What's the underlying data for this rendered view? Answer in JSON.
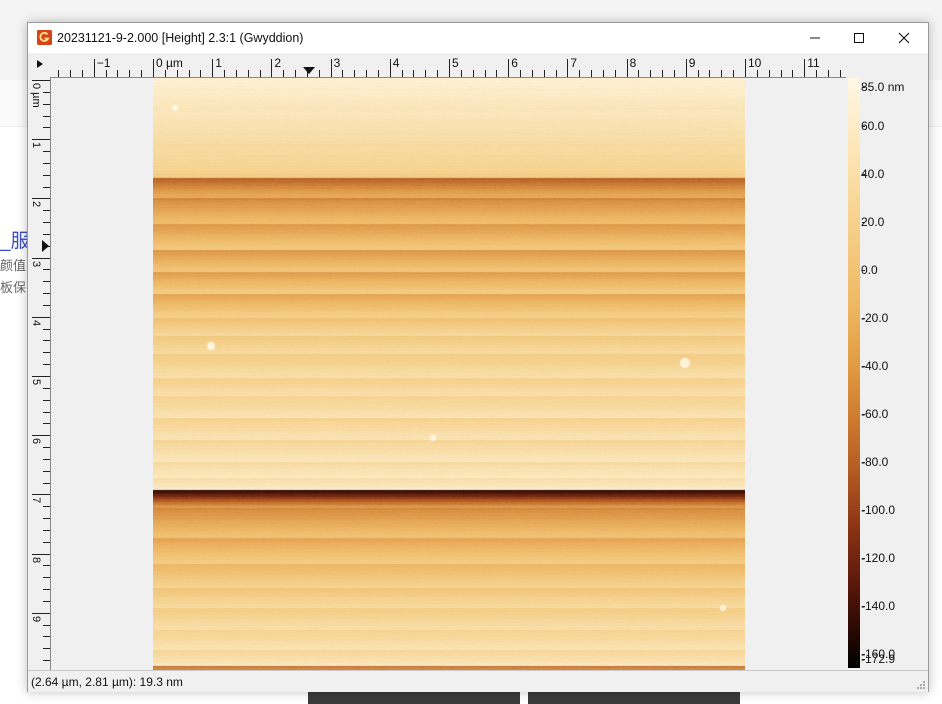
{
  "background": {
    "link_text": "_服",
    "line1": "颜值",
    "line2": "板保"
  },
  "window": {
    "title": "20231121-9-2.000 [Height] 2.3:1 (Gwyddion)",
    "minimize_label": "—",
    "maximize_label": "☐",
    "close_label": "✕"
  },
  "hruler": {
    "labels": [
      "−1",
      "0 µm",
      "1",
      "2",
      "3",
      "4",
      "5",
      "6",
      "7",
      "8",
      "9",
      "10",
      "11"
    ]
  },
  "vruler": {
    "labels": [
      "0 µm",
      "1",
      "2",
      "3",
      "4",
      "5",
      "6",
      "7",
      "8",
      "9"
    ]
  },
  "colorbar": {
    "labels": [
      "85.0 nm",
      "60.0",
      "40.0",
      "20.0",
      "0.0",
      "-20.0",
      "-40.0",
      "-60.0",
      "-80.0",
      "-100.0",
      "-120.0",
      "-140.0",
      "-160.0",
      "-172.9"
    ],
    "gradient_colors": [
      "#fff8e5",
      "#f6d08a",
      "#e29e45",
      "#b25a22",
      "#5f1a0c",
      "#000000"
    ]
  },
  "status": {
    "text": "(2.64 µm, 2.81 µm): 19.3 nm"
  }
}
